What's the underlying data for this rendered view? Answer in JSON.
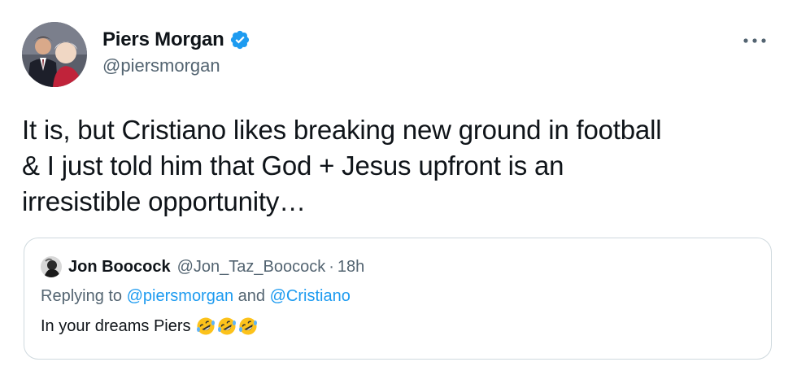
{
  "tweet": {
    "author": {
      "display_name": "Piers Morgan",
      "handle": "@piersmorgan",
      "verified": true,
      "avatar_icon": "profile-photo"
    },
    "more_icon": "more-horizontal-icon",
    "text": "It is, but Cristiano likes breaking new ground in football\n& I just told him that God + Jesus upfront is an\nirresistible opportunity…"
  },
  "quote": {
    "author_name": "Jon Boocock",
    "author_handle": "@Jon_Taz_Boocock",
    "separator": "·",
    "time": "18h",
    "replying_prefix": "Replying to",
    "replying_mention_1": "@piersmorgan",
    "replying_and": "and",
    "replying_mention_2": "@Cristiano",
    "text": "In your dreams Piers",
    "emojis": [
      "rolling-on-floor-laughing-emoji",
      "rolling-on-floor-laughing-emoji",
      "rolling-on-floor-laughing-emoji"
    ]
  },
  "colors": {
    "text_primary": "#0f1419",
    "text_secondary": "#536471",
    "accent": "#1d9bf0",
    "border": "#cfd9de"
  }
}
